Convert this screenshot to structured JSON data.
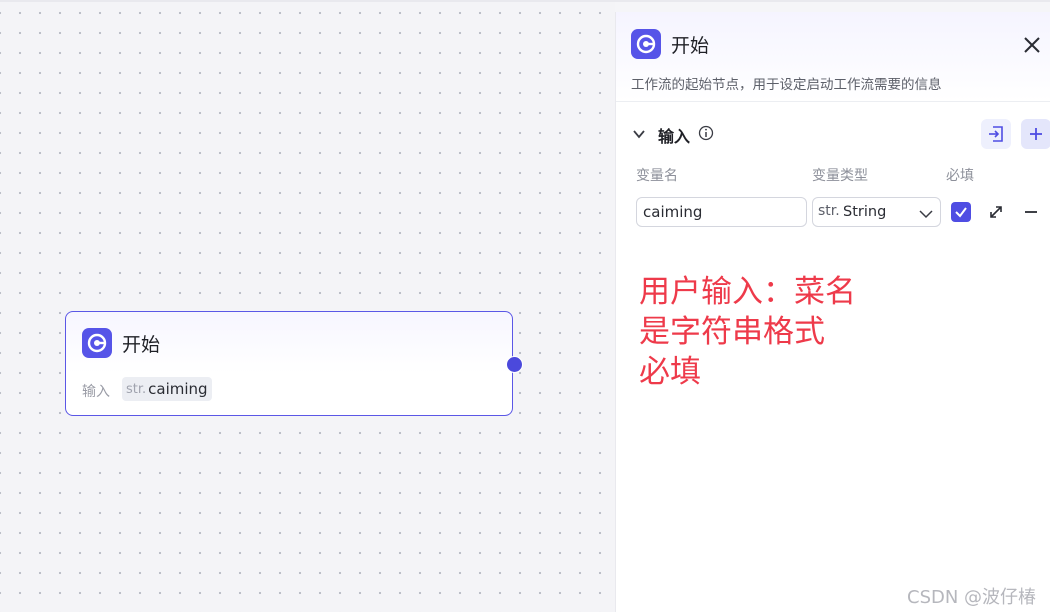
{
  "canvas": {
    "node": {
      "title": "开始",
      "input_label": "输入",
      "var_type": "str.",
      "var_name": "caiming"
    }
  },
  "panel": {
    "title": "开始",
    "description": "工作流的起始节点，用于设定启动工作流需要的信息",
    "section": {
      "title": "输入",
      "columns": {
        "name": "变量名",
        "type": "变量类型",
        "required": "必填"
      },
      "row": {
        "name_value": "caiming",
        "type_prefix": "str.",
        "type_value": "String",
        "required": true
      }
    }
  },
  "annotation": "用户输入：菜名\n是字符串格式\n必填",
  "watermark": "CSDN @波仔椿",
  "colors": {
    "accent": "#5654e8",
    "annotation": "#ee3a4a"
  }
}
